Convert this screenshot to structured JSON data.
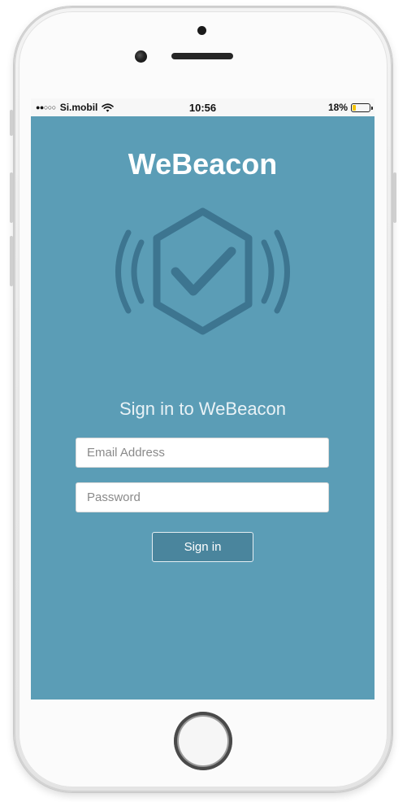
{
  "device": {
    "name": "phone"
  },
  "status_bar": {
    "signal_dots": "●●○○○",
    "carrier": "Si.mobil",
    "wifi_icon": "wifi-icon",
    "time": "10:56",
    "battery_percent": "18%",
    "battery_level": 0.18,
    "battery_color": "#f5c400"
  },
  "app": {
    "title": "WeBeacon",
    "logo_icon": "beacon-shield-check-icon",
    "logo_color": "#3d7590",
    "background_color": "#5b9db6"
  },
  "signin": {
    "heading": "Sign in to WeBeacon",
    "email_placeholder": "Email Address",
    "password_placeholder": "Password",
    "button_label": "Sign in"
  }
}
